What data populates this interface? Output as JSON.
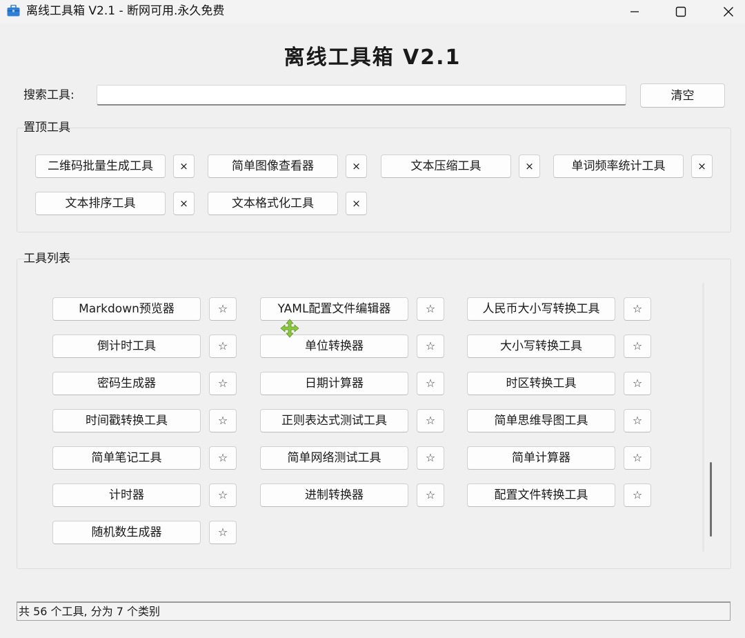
{
  "window": {
    "title": "离线工具箱 V2.1 - 断网可用.永久免费",
    "app_icon": "toolbox-icon",
    "controls": [
      "minimize-icon",
      "maximize-icon",
      "close-icon"
    ]
  },
  "header": {
    "title": "离线工具箱 V2.1"
  },
  "search": {
    "label": "搜索工具:",
    "value": "",
    "placeholder": "",
    "clear_label": "清空"
  },
  "pinned": {
    "title": "置顶工具",
    "remove_label": "×",
    "items": [
      {
        "label": "二维码批量生成工具"
      },
      {
        "label": "简单图像查看器"
      },
      {
        "label": "文本压缩工具"
      },
      {
        "label": "单词频率统计工具"
      },
      {
        "label": "文本排序工具"
      },
      {
        "label": "文本格式化工具"
      }
    ]
  },
  "tools": {
    "title": "工具列表",
    "pin_label": "☆",
    "items": [
      {
        "label": "Markdown预览器"
      },
      {
        "label": "YAML配置文件编辑器"
      },
      {
        "label": "人民币大小写转换工具"
      },
      {
        "label": "倒计时工具"
      },
      {
        "label": "单位转换器"
      },
      {
        "label": "大小写转换工具"
      },
      {
        "label": "密码生成器"
      },
      {
        "label": "日期计算器"
      },
      {
        "label": "时区转换工具"
      },
      {
        "label": "时间戳转换工具"
      },
      {
        "label": "正则表达式测试工具"
      },
      {
        "label": "简单思维导图工具"
      },
      {
        "label": "简单笔记工具"
      },
      {
        "label": "简单网络测试工具"
      },
      {
        "label": "简单计算器"
      },
      {
        "label": "计时器"
      },
      {
        "label": "进制转换器"
      },
      {
        "label": "配置文件转换工具"
      },
      {
        "label": "随机数生成器"
      }
    ]
  },
  "status": {
    "text": "共 56 个工具, 分为 7 个类别"
  },
  "colors": {
    "background": "#f0f0f0",
    "button_bg": "#fdfdfd",
    "border": "#d0d0d0",
    "cursor_accent": "#8cc63f",
    "app_icon_blue": "#2f7fd6"
  }
}
